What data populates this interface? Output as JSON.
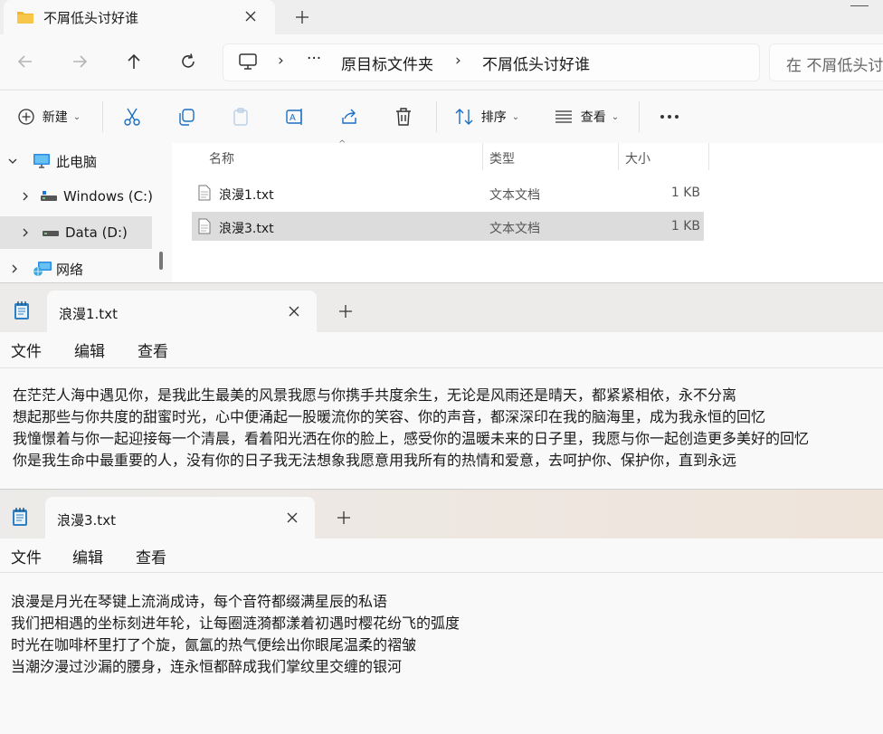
{
  "explorer": {
    "tab_title": "不屑低头讨好谁",
    "breadcrumb": [
      "原目标文件夹",
      "不屑低头讨好谁"
    ],
    "search_placeholder": "在 不屑低头讨",
    "toolbar": {
      "new_label": "新建",
      "sort_label": "排序",
      "view_label": "查看"
    },
    "nav": [
      {
        "label": "此电脑",
        "icon": "computer-icon"
      },
      {
        "label": "Windows (C:)",
        "icon": "drive-icon"
      },
      {
        "label": "Data (D:)",
        "icon": "drive-icon"
      },
      {
        "label": "网络",
        "icon": "network-icon"
      }
    ],
    "columns": [
      "名称",
      "类型",
      "大小"
    ],
    "files": [
      {
        "name": "浪漫1.txt",
        "type": "文本文档",
        "size": "1 KB"
      },
      {
        "name": "浪漫3.txt",
        "type": "文本文档",
        "size": "1 KB"
      }
    ]
  },
  "notepad1": {
    "tab_title": "浪漫1.txt",
    "menu": [
      "文件",
      "编辑",
      "查看"
    ],
    "lines": [
      "在茫茫人海中遇见你，是我此生最美的风景我愿与你携手共度余生，无论是风雨还是晴天，都紧紧相依，永不分离",
      "想起那些与你共度的甜蜜时光，心中便涌起一股暖流你的笑容、你的声音，都深深印在我的脑海里，成为我永恒的回忆",
      "我憧憬着与你一起迎接每一个清晨，看着阳光洒在你的脸上，感受你的温暖未来的日子里，我愿与你一起创造更多美好的回忆",
      "你是我生命中最重要的人，没有你的日子我无法想象我愿意用我所有的热情和爱意，去呵护你、保护你，直到永远"
    ]
  },
  "notepad2": {
    "tab_title": "浪漫3.txt",
    "menu": [
      "文件",
      "编辑",
      "查看"
    ],
    "lines": [
      "浪漫是月光在琴键上流淌成诗，每个音符都缀满星辰的私语",
      "我们把相遇的坐标刻进年轮，让每圈涟漪都漾着初遇时樱花纷飞的弧度",
      "时光在咖啡杯里打了个旋，氤氲的热气便绘出你眼尾温柔的褶皱",
      "当潮汐漫过沙漏的腰身，连永恒都醉成我们掌纹里交缠的银河"
    ]
  }
}
